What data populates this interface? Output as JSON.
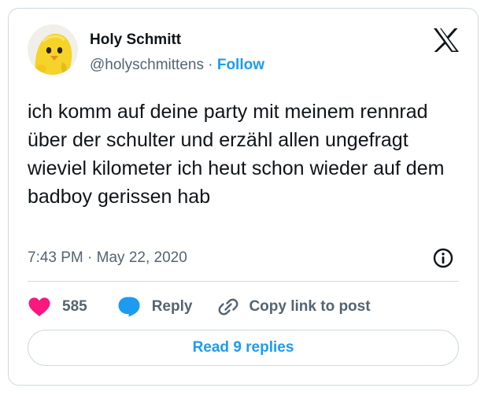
{
  "author": {
    "display_name": "Holy Schmitt",
    "handle": "@holyschmittens",
    "separator": "·",
    "follow_label": "Follow"
  },
  "tweet": {
    "text": "ich komm auf deine party mit meinem rennrad über der schulter und erzähl allen ungefragt wieviel kilometer ich heut schon wieder auf dem badboy gerissen hab",
    "timestamp": "7:43 PM · May 22, 2020"
  },
  "actions": {
    "like_count": "585",
    "reply_label": "Reply",
    "copy_link_label": "Copy link to post"
  },
  "read_replies_label": "Read 9 replies",
  "colors": {
    "accent": "#1d9bf0",
    "like": "#f91880",
    "text": "#0f1419",
    "muted": "#536471",
    "border": "#cfd9de"
  },
  "icons": {
    "brand": "x-logo-icon",
    "info": "info-icon",
    "like": "heart-icon",
    "reply": "speech-bubble-icon",
    "copy_link": "link-icon"
  }
}
